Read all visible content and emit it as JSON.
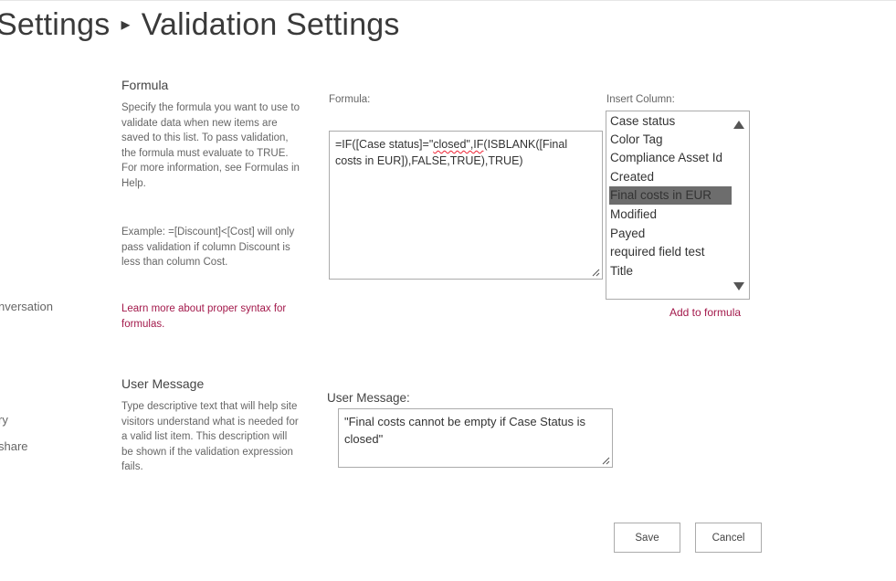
{
  "header": {
    "crumb": "Settings",
    "separator": "▸",
    "title": "Validation Settings"
  },
  "left_nav": {
    "item1": "nversation",
    "item2": "ry",
    "item3": "share"
  },
  "formula_section": {
    "heading": "Formula",
    "description": "Specify the formula you want to use to validate data when new items are saved to this list. To pass validation, the formula must evaluate to TRUE. For more information, see Formulas in Help.",
    "example": "Example: =[Discount]<[Cost] will only pass validation if column Discount is less than column Cost.",
    "learn_more_link": "Learn more about proper syntax for formulas.",
    "field_label": "Formula:",
    "value_part1": "=IF([Case status]=\"",
    "value_part2": "closed\",IF",
    "value_part3": "(ISBLANK([Final costs in EUR]),FALSE,TRUE),TRUE)"
  },
  "insert_column": {
    "label": "Insert Column:",
    "items": [
      "Case status",
      "Color Tag",
      "Compliance Asset Id",
      "Created",
      "Final costs in EUR",
      "Modified",
      "Payed",
      "required field test",
      "Title"
    ],
    "selected": "Final costs in EUR",
    "add_link": "Add to formula"
  },
  "message_section": {
    "heading": "User Message",
    "description": "Type descriptive text that will help site visitors understand what is needed for a valid list item. This description will be shown if the validation expression fails.",
    "field_label": "User Message:",
    "value": "\"Final costs cannot be empty if Case Status is closed\""
  },
  "buttons": {
    "save": "Save",
    "cancel": "Cancel"
  },
  "colors": {
    "link": "#a3194b",
    "selected_bg": "#6d6d6d"
  }
}
